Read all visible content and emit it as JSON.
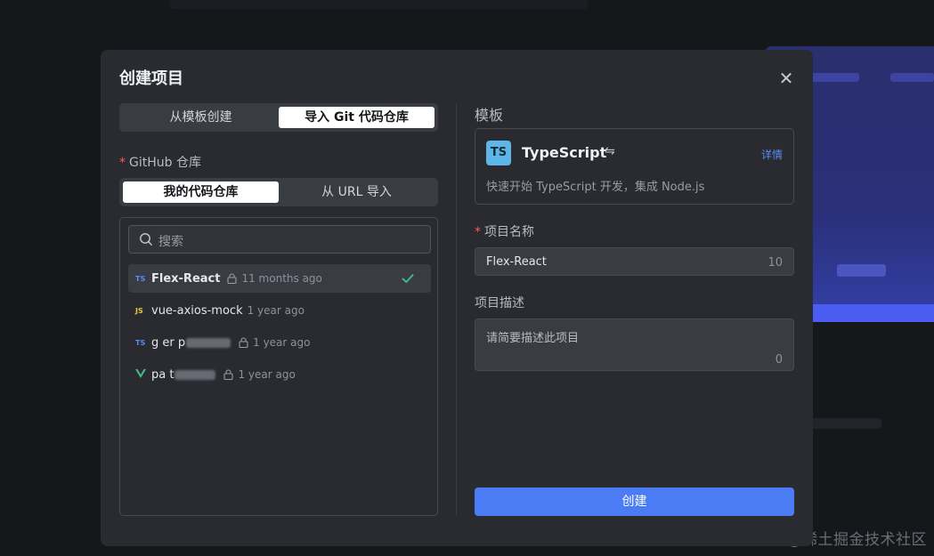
{
  "modal": {
    "title": "创建项目",
    "close_glyph": "✕"
  },
  "source_tabs": [
    {
      "label": "从模板创建",
      "active": false
    },
    {
      "label": "导入 Git 代码仓库",
      "active": true
    }
  ],
  "github": {
    "label": "GitHub 仓库",
    "required_mark": "*",
    "tabs": [
      {
        "label": "我的代码仓库",
        "active": true
      },
      {
        "label": "从 URL 导入",
        "active": false
      }
    ],
    "search_placeholder": "搜索",
    "repos": [
      {
        "lang": "TS",
        "name": "Flex-React",
        "time": "11 months ago",
        "selected": true,
        "lock": true
      },
      {
        "lang": "JS",
        "name": "vue-axios-mock",
        "time": "1 year ago",
        "selected": false,
        "lock": false
      },
      {
        "lang": "TS",
        "name": "g er p",
        "time": "1 year ago",
        "selected": false,
        "lock": true
      },
      {
        "lang": "V",
        "name": "pa t",
        "time": "1 year ago",
        "selected": false,
        "lock": true
      }
    ]
  },
  "template": {
    "section_title": "模板",
    "badge": "TS",
    "name": "TypeScript",
    "swap_glyph": "⇋",
    "detail_link": "详情",
    "description": "快速开始 TypeScript 开发，集成 Node.js"
  },
  "project_name": {
    "label": "项目名称",
    "required_mark": "*",
    "value": "Flex-React",
    "count": "10"
  },
  "project_desc": {
    "label": "项目描述",
    "placeholder": "请简要描述此项目",
    "count": "0"
  },
  "create_button": "创建",
  "watermark": "@稀土掘金技术社区",
  "colors": {
    "accent": "#4b7cf6",
    "check": "#42b883",
    "required": "#f25a5a"
  },
  "icons": {
    "search": "search-icon",
    "lock": "lock-icon",
    "check": "check-icon",
    "swap": "swap-icon",
    "close": "close-icon"
  }
}
